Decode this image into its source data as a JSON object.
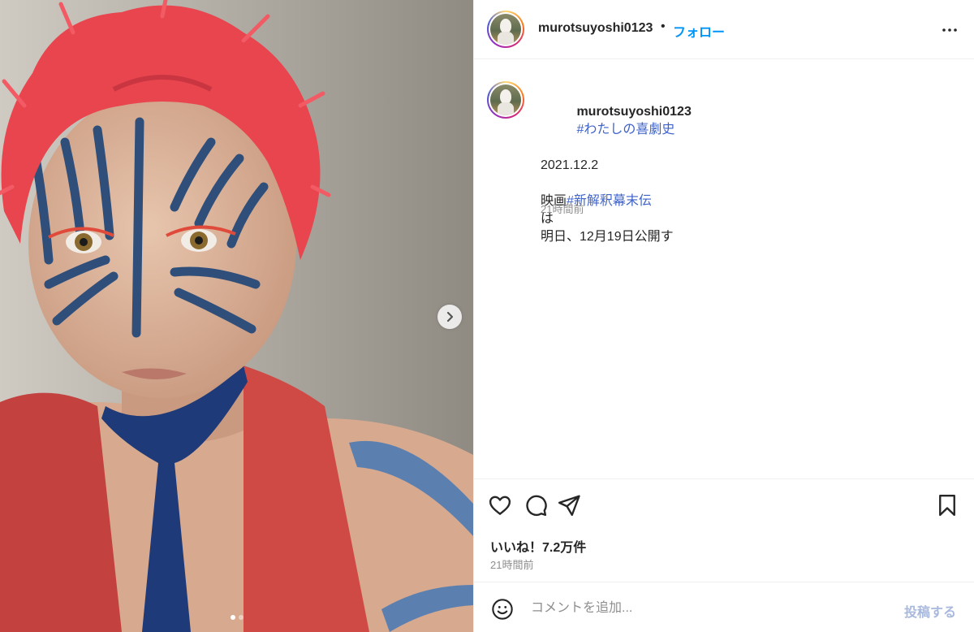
{
  "post": {
    "username": "murotsuyoshi0123",
    "separator": "•",
    "follow_label": "フォロー",
    "more_icon": "more-horizontal-icon",
    "caption": {
      "hashtag": "#わたしの喜劇史",
      "date": "2021.12.2",
      "line_movie_prefix": "映画",
      "hashtag_movie": "#新解釈幕末伝",
      "line_particle": "は",
      "line_release": "明日、12月19日公開す",
      "time_ago": "21時間前"
    },
    "actions": {
      "like_icon": "heart-icon",
      "comment_icon": "comment-icon",
      "share_icon": "share-icon",
      "save_icon": "bookmark-icon"
    },
    "likes_text": "いいね！7.2万件",
    "posted_ago": "21時間前",
    "composer": {
      "emoji_icon": "emoji-icon",
      "placeholder": "コメントを追加...",
      "post_label": "投稿する"
    },
    "media": {
      "next_icon": "chevron-right-icon",
      "carousel_count": 2,
      "carousel_active_index": 0
    },
    "colors": {
      "link_blue": "#0095f6",
      "hashtag_blue": "#3f63c8",
      "muted_gray": "#8e8e8e",
      "post_button_disabled": "#a9b9de",
      "wig_red": "#e8454e",
      "face_paint_blue": "#2f4f7a"
    }
  }
}
